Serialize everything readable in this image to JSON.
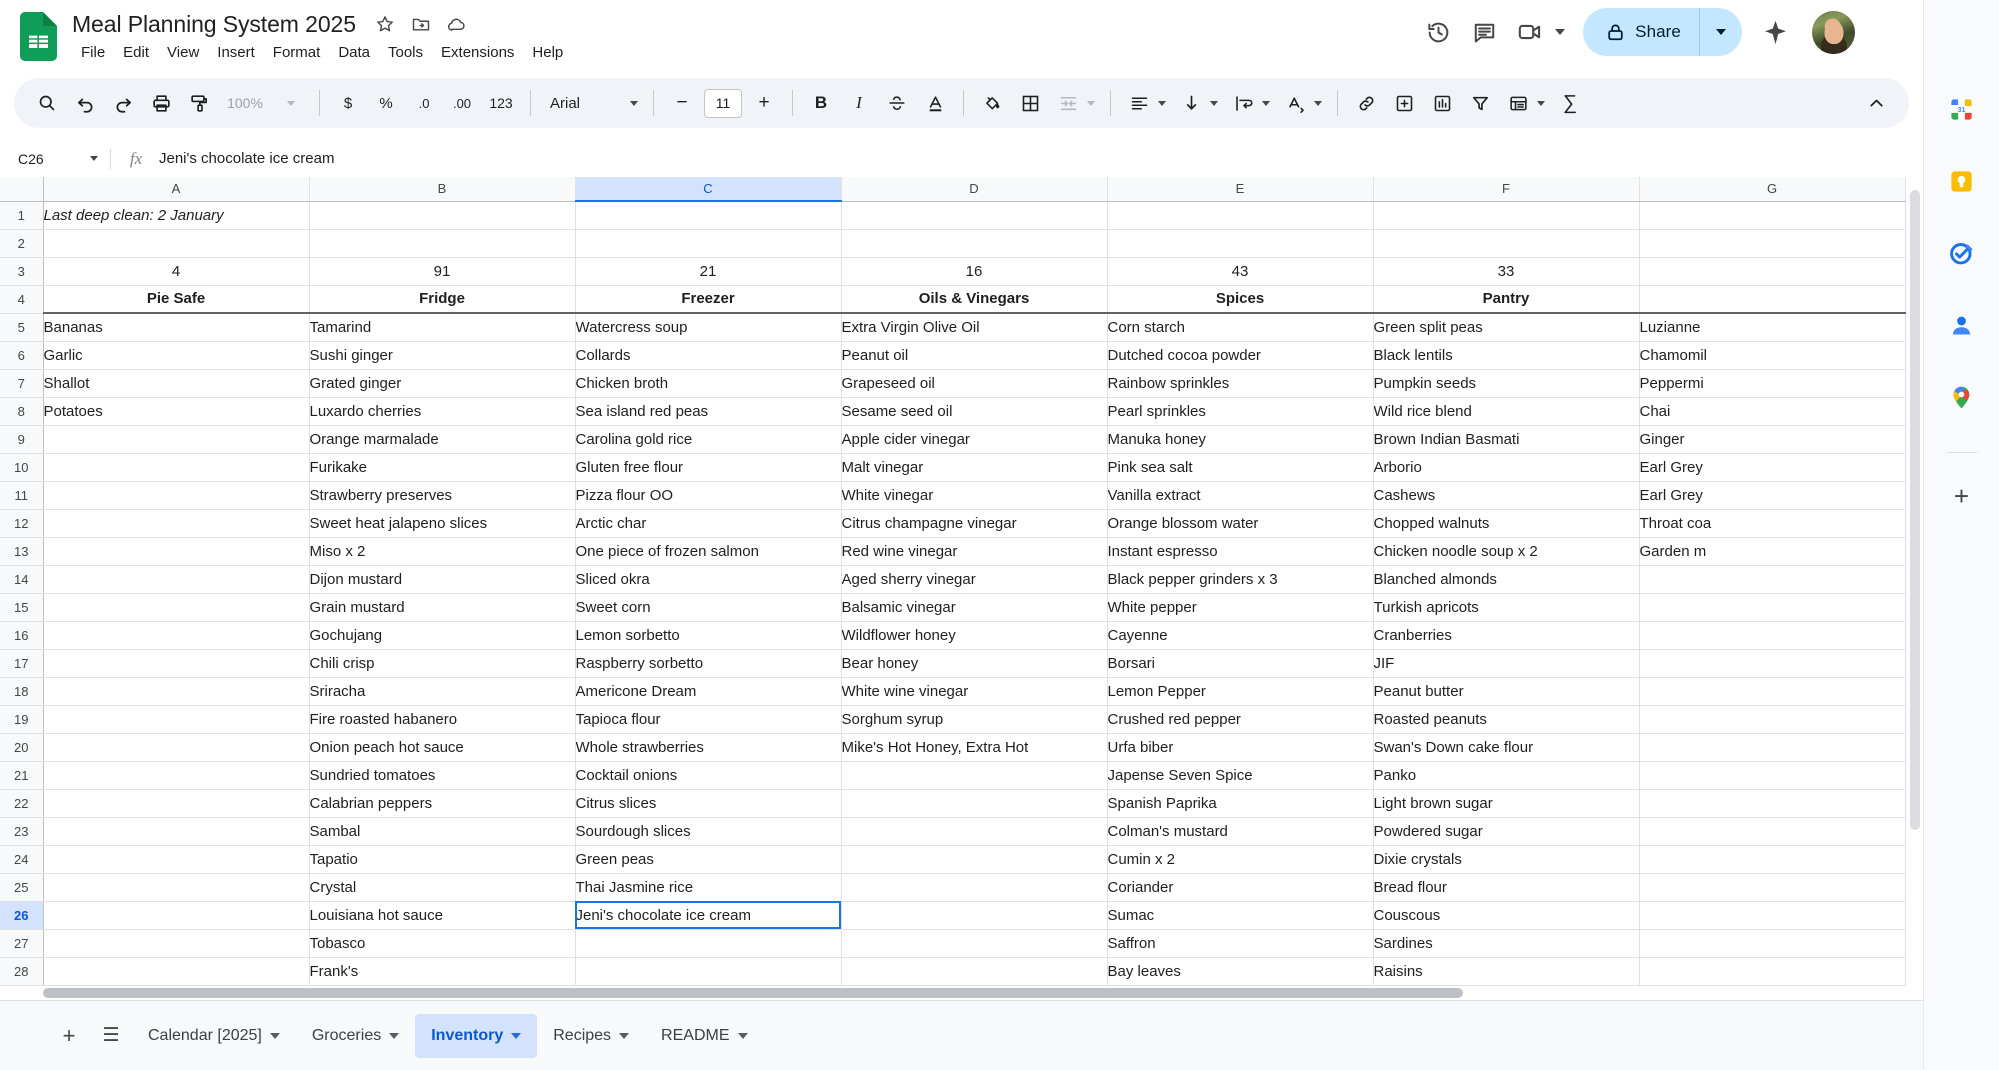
{
  "app": {
    "doc_title": "Meal Planning System 2025",
    "logo_name": "google-sheets-logo"
  },
  "menubar": {
    "items": [
      "File",
      "Edit",
      "View",
      "Insert",
      "Format",
      "Data",
      "Tools",
      "Extensions",
      "Help"
    ]
  },
  "title_icons": [
    {
      "name": "star-icon",
      "glyph": "☆"
    },
    {
      "name": "move-to-folder-icon",
      "glyph": "❐"
    },
    {
      "name": "cloud-saved-icon",
      "glyph": "☁"
    }
  ],
  "top_right": {
    "version_history_label": "version-history-icon",
    "comment_label": "comment-icon",
    "meet_label": "meet-icon",
    "share_label": "Share",
    "gemini_label": "gemini-sparkle-icon",
    "avatar_label": "account-avatar"
  },
  "toolbar": {
    "search": "search-icon",
    "undo": "undo-icon",
    "redo": "redo-icon",
    "print": "print-icon",
    "paint_format": "paint-format-icon",
    "zoom_value": "100%",
    "currency": "$",
    "percent": "%",
    "decimal_decrease": ".0",
    "decimal_increase": ".00",
    "more_formats": "123",
    "font_name": "Arial",
    "font_size_decrease": "−",
    "font_size": "11",
    "font_size_increase": "+",
    "bold": "B",
    "italic": "I",
    "strikethrough": "S",
    "text_color": "A",
    "fill_color": "fill-color-icon",
    "borders": "borders-icon",
    "merge_cells": "merge-cells-icon",
    "horizontal_align": "horizontal-align-icon",
    "vertical_align": "vertical-align-icon",
    "text_wrapping": "text-wrapping-icon",
    "text_rotation": "text-rotation-icon",
    "insert_link": "insert-link-icon",
    "insert_comment": "insert-comment-icon",
    "insert_chart": "insert-chart-icon",
    "create_filter": "create-filter-icon",
    "functions": "functions-icon",
    "sigma": "∑",
    "collapse": "collapse-toolbar-icon"
  },
  "formula_bar": {
    "name_box": "C26",
    "fx_label": "fx",
    "value": "Jeni's chocolate ice cream"
  },
  "grid": {
    "columns": [
      "A",
      "B",
      "C",
      "D",
      "E",
      "F",
      "G"
    ],
    "selected_column": "C",
    "selected_row": 26,
    "selected_cell": "C26",
    "row_numbers": [
      1,
      2,
      3,
      4,
      5,
      6,
      7,
      8,
      9,
      10,
      11,
      12,
      13,
      14,
      15,
      16,
      17,
      18,
      19,
      20,
      21,
      22,
      23,
      24,
      25,
      26,
      27,
      28
    ],
    "note_row1": "Last deep clean: 2 January",
    "counts": [
      "4",
      "91",
      "21",
      "16",
      "43",
      "33",
      ""
    ],
    "headers": [
      "Pie Safe",
      "Fridge",
      "Freezer",
      "Oils & Vinegars",
      "Spices",
      "Pantry",
      ""
    ],
    "data": {
      "A": [
        "Bananas",
        "Garlic",
        "Shallot",
        "Potatoes",
        "",
        "",
        "",
        "",
        "",
        "",
        "",
        "",
        "",
        "",
        "",
        "",
        "",
        "",
        "",
        "",
        "",
        "",
        "",
        ""
      ],
      "B": [
        "Tamarind",
        "Sushi ginger",
        "Grated ginger",
        "Luxardo cherries",
        "Orange marmalade",
        "Furikake",
        "Strawberry preserves",
        "Sweet heat jalapeno slices",
        "Miso x 2",
        "Dijon mustard",
        "Grain mustard",
        "Gochujang",
        "Chili crisp",
        "Sriracha",
        "Fire roasted habanero",
        "Onion peach hot sauce",
        "Sundried tomatoes",
        "Calabrian peppers",
        "Sambal",
        "Tapatio",
        "Crystal",
        "Louisiana hot sauce",
        "Tobasco",
        "Frank's"
      ],
      "C": [
        "Watercress soup",
        "Collards",
        "Chicken broth",
        "Sea island red peas",
        "Carolina gold rice",
        "Gluten free flour",
        "Pizza flour OO",
        "Arctic char",
        "One piece of frozen salmon",
        "Sliced okra",
        "Sweet corn",
        "Lemon sorbetto",
        "Raspberry sorbetto",
        "Americone Dream",
        "Tapioca flour",
        "Whole strawberries",
        "Cocktail onions",
        "Citrus slices",
        "Sourdough slices",
        "Green peas",
        "Thai Jasmine rice",
        "Jeni's chocolate ice cream",
        "",
        ""
      ],
      "D": [
        "Extra Virgin Olive Oil",
        "Peanut oil",
        "Grapeseed oil",
        "Sesame seed oil",
        "Apple cider vinegar",
        "Malt vinegar",
        "White vinegar",
        "Citrus champagne vinegar",
        "Red wine vinegar",
        "Aged sherry vinegar",
        "Balsamic vinegar",
        "Wildflower honey",
        "Bear honey",
        "White wine vinegar",
        "Sorghum syrup",
        "Mike's Hot Honey, Extra Hot",
        "",
        "",
        "",
        "",
        "",
        "",
        "",
        ""
      ],
      "E": [
        "Corn starch",
        "Dutched cocoa powder",
        "Rainbow sprinkles",
        "Pearl sprinkles",
        "Manuka honey",
        "Pink sea salt",
        "Vanilla extract",
        "Orange blossom water",
        "Instant espresso",
        "Black pepper grinders x 3",
        "White pepper",
        "Cayenne",
        "Borsari",
        "Lemon Pepper",
        "Crushed red pepper",
        "Urfa biber",
        "Japense Seven Spice",
        "Spanish Paprika",
        "Colman's mustard",
        "Cumin x 2",
        "Coriander",
        "Sumac",
        "Saffron",
        "Bay leaves"
      ],
      "F": [
        "Green split peas",
        "Black lentils",
        "Pumpkin seeds",
        "Wild rice blend",
        "Brown Indian Basmati",
        "Arborio",
        "Cashews",
        "Chopped walnuts",
        "Chicken noodle soup x 2",
        "Blanched almonds",
        "Turkish apricots",
        "Cranberries",
        "JIF",
        "Peanut butter",
        "Roasted peanuts",
        "Swan's Down cake flour",
        "Panko",
        "Light brown sugar",
        "Powdered sugar",
        "Dixie crystals",
        "Bread flour",
        "Couscous",
        "Sardines",
        "Raisins"
      ],
      "G": [
        "Luzianne ",
        "Chamomil",
        "Peppermi",
        "Chai",
        "Ginger",
        "Earl Grey",
        "Earl Grey",
        "Throat coa",
        "Garden m",
        "",
        "",
        "",
        "",
        "",
        "",
        "",
        "",
        "",
        "",
        "",
        "",
        "",
        "",
        ""
      ]
    }
  },
  "sheet_tabs": {
    "add_sheet": "add-sheet-icon",
    "all_sheets": "all-sheets-icon",
    "tabs": [
      {
        "label": "Calendar [2025]",
        "active": false
      },
      {
        "label": "Groceries",
        "active": false
      },
      {
        "label": "Inventory",
        "active": true
      },
      {
        "label": "Recipes",
        "active": false
      },
      {
        "label": "README",
        "active": false
      }
    ]
  },
  "side_panel": {
    "items": [
      {
        "name": "google-calendar-icon",
        "label": "31"
      },
      {
        "name": "google-keep-icon",
        "label": ""
      },
      {
        "name": "google-tasks-icon",
        "label": ""
      },
      {
        "name": "google-contacts-icon",
        "label": ""
      },
      {
        "name": "google-maps-icon",
        "label": ""
      },
      {
        "name": "add-on-plus-icon",
        "label": "+"
      }
    ]
  },
  "colors": {
    "sheets_green": "#0f9d58",
    "accent_blue": "#1a73e8",
    "share_bg": "#c2e7ff",
    "selected_header_bg": "#d3e3fd",
    "toolbar_bg": "#f0f4f9"
  }
}
